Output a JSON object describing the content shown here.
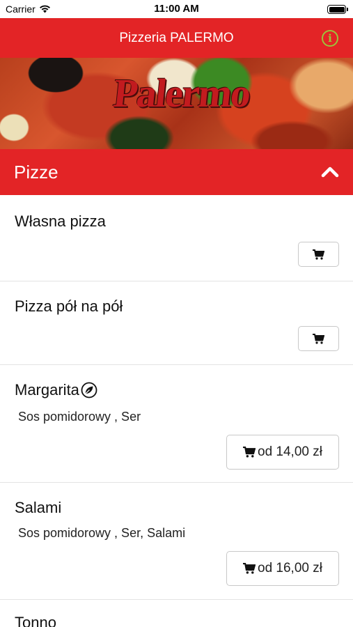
{
  "status_bar": {
    "carrier": "Carrier",
    "time": "11:00 AM"
  },
  "navbar": {
    "title": "Pizzeria PALERMO",
    "info_icon": "i"
  },
  "banner": {
    "logo_text": "Palermo"
  },
  "section": {
    "title": "Pizze",
    "expanded": true
  },
  "items": [
    {
      "name": "Własna pizza"
    },
    {
      "name": "Pizza pół na pół"
    },
    {
      "name": "Margarita",
      "vegetarian": true,
      "description": "Sos pomidorowy , Ser",
      "price": "od 14,00 zł"
    },
    {
      "name": "Salami",
      "description": "Sos pomidorowy , Ser, Salami",
      "price": "od 16,00 zł"
    },
    {
      "name": "Tonno"
    }
  ],
  "colors": {
    "brand_red": "#e32426",
    "info_green": "#9cc43a"
  }
}
